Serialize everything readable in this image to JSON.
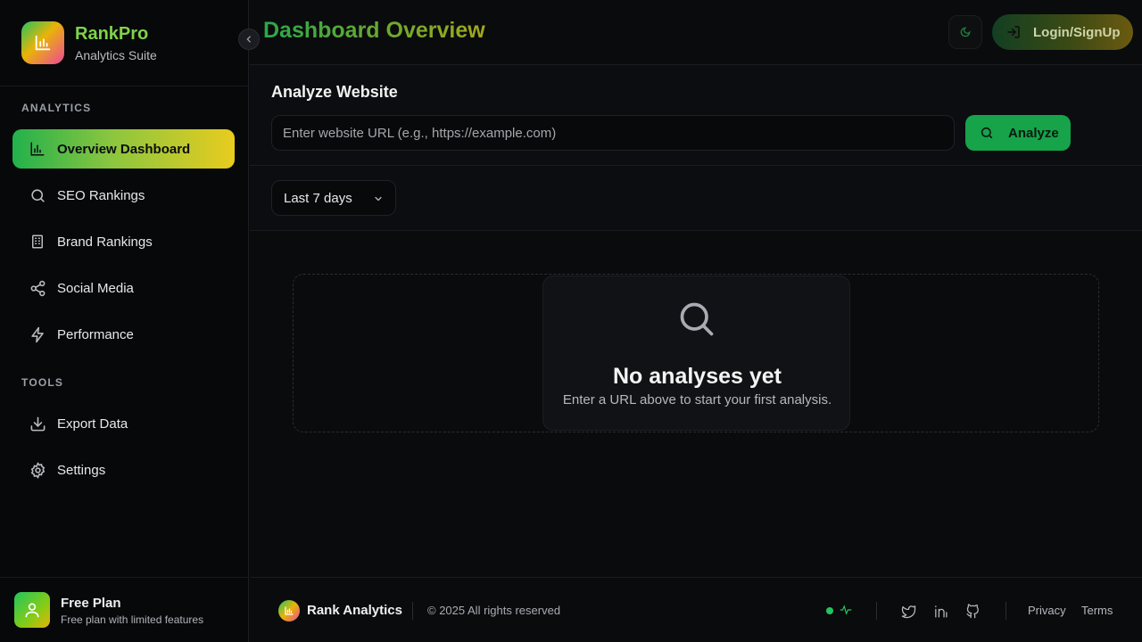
{
  "brand": {
    "name": "RankPro",
    "subtitle": "Analytics Suite"
  },
  "sidebar": {
    "sections": [
      {
        "label": "ANALYTICS"
      },
      {
        "label": "TOOLS"
      }
    ],
    "items": [
      {
        "label": "Overview Dashboard",
        "icon": "bar-chart-icon",
        "active": true
      },
      {
        "label": "SEO Rankings",
        "icon": "search-icon"
      },
      {
        "label": "Brand Rankings",
        "icon": "building-icon"
      },
      {
        "label": "Social Media",
        "icon": "share-icon"
      },
      {
        "label": "Performance",
        "icon": "lightning-icon"
      },
      {
        "label": "Export Data",
        "icon": "download-icon"
      },
      {
        "label": "Settings",
        "icon": "gear-icon"
      }
    ]
  },
  "plan": {
    "title": "Free Plan",
    "subtitle": "Free plan with limited features"
  },
  "header": {
    "title": "Dashboard Overview",
    "login_label": "Login/SignUp"
  },
  "analyze": {
    "title": "Analyze Website",
    "placeholder": "Enter website URL (e.g., https://example.com)",
    "value": "",
    "button_label": "Analyze"
  },
  "filter": {
    "range_label": "Last 7 days"
  },
  "empty_state": {
    "title": "No analyses yet",
    "subtitle": "Enter a URL above to start your first analysis."
  },
  "footer": {
    "brand": "Rank Analytics",
    "copyright": "© 2025 All rights reserved",
    "links": [
      "Privacy",
      "Terms"
    ]
  },
  "colors": {
    "accent_green": "#16a34a",
    "accent_yellow": "#e8cc1e",
    "background": "#0a0b0d"
  }
}
